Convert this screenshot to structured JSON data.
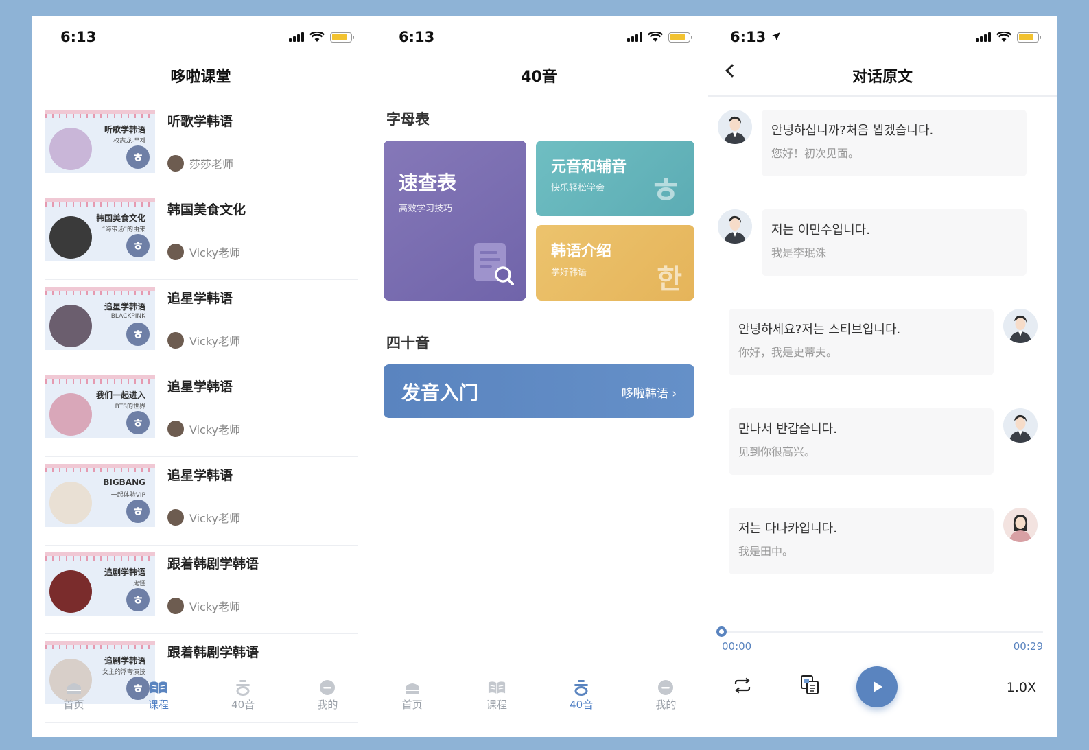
{
  "statusbar": {
    "time": "6:13"
  },
  "phone1": {
    "title": "哆啦课堂",
    "courses": [
      {
        "title": "听歌学韩语",
        "teacher": "莎莎老师",
        "thumb_line1": "听歌学韩语",
        "thumb_line2": "权志龙-무제"
      },
      {
        "title": "韩国美食文化",
        "teacher": "Vicky老师",
        "thumb_line1": "韩国美食文化",
        "thumb_line2": "“海带汤”的由来"
      },
      {
        "title": "追星学韩语",
        "teacher": "Vicky老师",
        "thumb_line1": "追星学韩语",
        "thumb_line2": "BLACKPINK"
      },
      {
        "title": "追星学韩语",
        "teacher": "Vicky老师",
        "thumb_line1": "我们一起进入",
        "thumb_line2": "BTS的世界"
      },
      {
        "title": "追星学韩语",
        "teacher": "Vicky老师",
        "thumb_line1": "BIGBANG",
        "thumb_line2": "一起体验VIP"
      },
      {
        "title": "跟着韩剧学韩语",
        "teacher": "Vicky老师",
        "thumb_line1": "追剧学韩语",
        "thumb_line2": "鬼怪"
      },
      {
        "title": "跟着韩剧学韩语",
        "teacher": "",
        "thumb_line1": "追剧学韩语",
        "thumb_line2": "女主的浮夸演技"
      }
    ],
    "badge_glyph": "ㅎ"
  },
  "tabs": {
    "home": "首页",
    "course": "课程",
    "sound40": "40音",
    "mine": "我的"
  },
  "phone2": {
    "title": "40音",
    "alphabet_section": "字母表",
    "quick": {
      "title": "速查表",
      "subtitle": "高效学习技巧"
    },
    "vowel": {
      "title": "元音和辅音",
      "subtitle": "快乐轻松学会",
      "glyph": "ㅎ"
    },
    "intro": {
      "title": "韩语介绍",
      "subtitle": "学好韩语",
      "glyph": "한"
    },
    "forty_section": "四十音",
    "pron": {
      "title": "发音入门",
      "link": "哆啦韩语 ›"
    }
  },
  "phone3": {
    "title": "对话原文",
    "messages": [
      {
        "side": "left",
        "ko": "안녕하십니까?처음 뵙겠습니다.",
        "zh": "您好！初次见面。"
      },
      {
        "side": "left",
        "ko": "저는 이민수입니다.",
        "zh": "我是李珉洙"
      },
      {
        "side": "right",
        "ko": "안녕하세요?저는 스티브입니다.",
        "zh": "你好，我是史蒂夫。"
      },
      {
        "side": "right",
        "ko": "만나서 반갑습니다.",
        "zh": "见到你很高兴。"
      },
      {
        "side": "right",
        "ko": "저는 다나카입니다.",
        "zh": "我是田中。"
      }
    ],
    "player": {
      "current": "00:00",
      "total": "00:29",
      "speed": "1.0X",
      "progress": 0
    }
  },
  "colors": {
    "accent": "#5a84bf",
    "background": "#8eb3d6",
    "purple_card": "#7a6db0",
    "teal_card": "#62b4bb",
    "gold_card": "#e8bb63"
  }
}
